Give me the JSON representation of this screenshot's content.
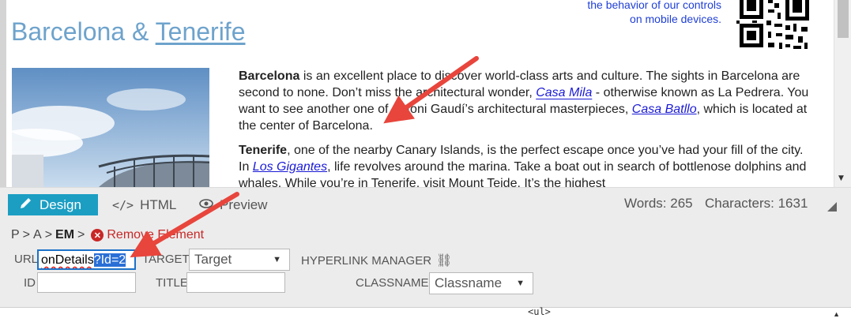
{
  "editor": {
    "tagline_line1": "the behavior of our controls",
    "tagline_line2": "on mobile devices.",
    "title_part1": "Barcelona & ",
    "title_part2": "Tenerife",
    "p1": {
      "bold": "Barcelona",
      "t1": " is an excellent place to discover world-class arts and culture. The sights in Barcelona are second to none. Don’t miss the architectural wonder, ",
      "link1": "Casa Mila",
      "t2": " - otherwise known as La Pedrera. You want to see another one of Antoni Gaudí’s architectural masterpieces, ",
      "link2": "Casa Batllo",
      "t3": ", which is located at the center of Barcelona."
    },
    "p2": {
      "bold": "Tenerife",
      "t1": ", one of the nearby Canary Islands, is the perfect escape once you’ve had your fill of the city. In ",
      "link1": "Los Gigantes",
      "t2": ", life revolves around the marina. Take a boat out in search of bottlenose dolphins and whales. While you’re in Tenerife, visit Mount Teide. It’s the highest"
    }
  },
  "toolbar": {
    "design_label": "Design",
    "html_label": "HTML",
    "preview_label": "Preview",
    "words": "Words: 265",
    "characters": "Characters: 1631"
  },
  "panel": {
    "crumb_p": "P",
    "crumb_a": "A",
    "crumb_em": "EM",
    "sep": ">",
    "remove_label": "Remove Element",
    "url_label": "URL",
    "url_value_plain": "onDetails",
    "url_value_selected": "?Id=2",
    "target_label": "TARGET",
    "target_value": "Target",
    "hyperlink_manager_label": "HYPERLINK MANAGER",
    "id_label": "ID",
    "id_value": "",
    "title_label": "TITLE",
    "title_value": "",
    "classname_label": "CLASSNAME",
    "classname_value": "Classname"
  },
  "source": {
    "snippet": "<ul>"
  },
  "colors": {
    "accent": "#1c9ec3",
    "link": "#1a1ad6",
    "title": "#6ea3cc",
    "arrow": "#e8453c",
    "selection": "#2a6fd6"
  },
  "icons": [
    "pencil-icon",
    "code-icon",
    "eye-icon",
    "remove-icon",
    "link-icon",
    "caret-down-icon",
    "qr-code-icon"
  ]
}
